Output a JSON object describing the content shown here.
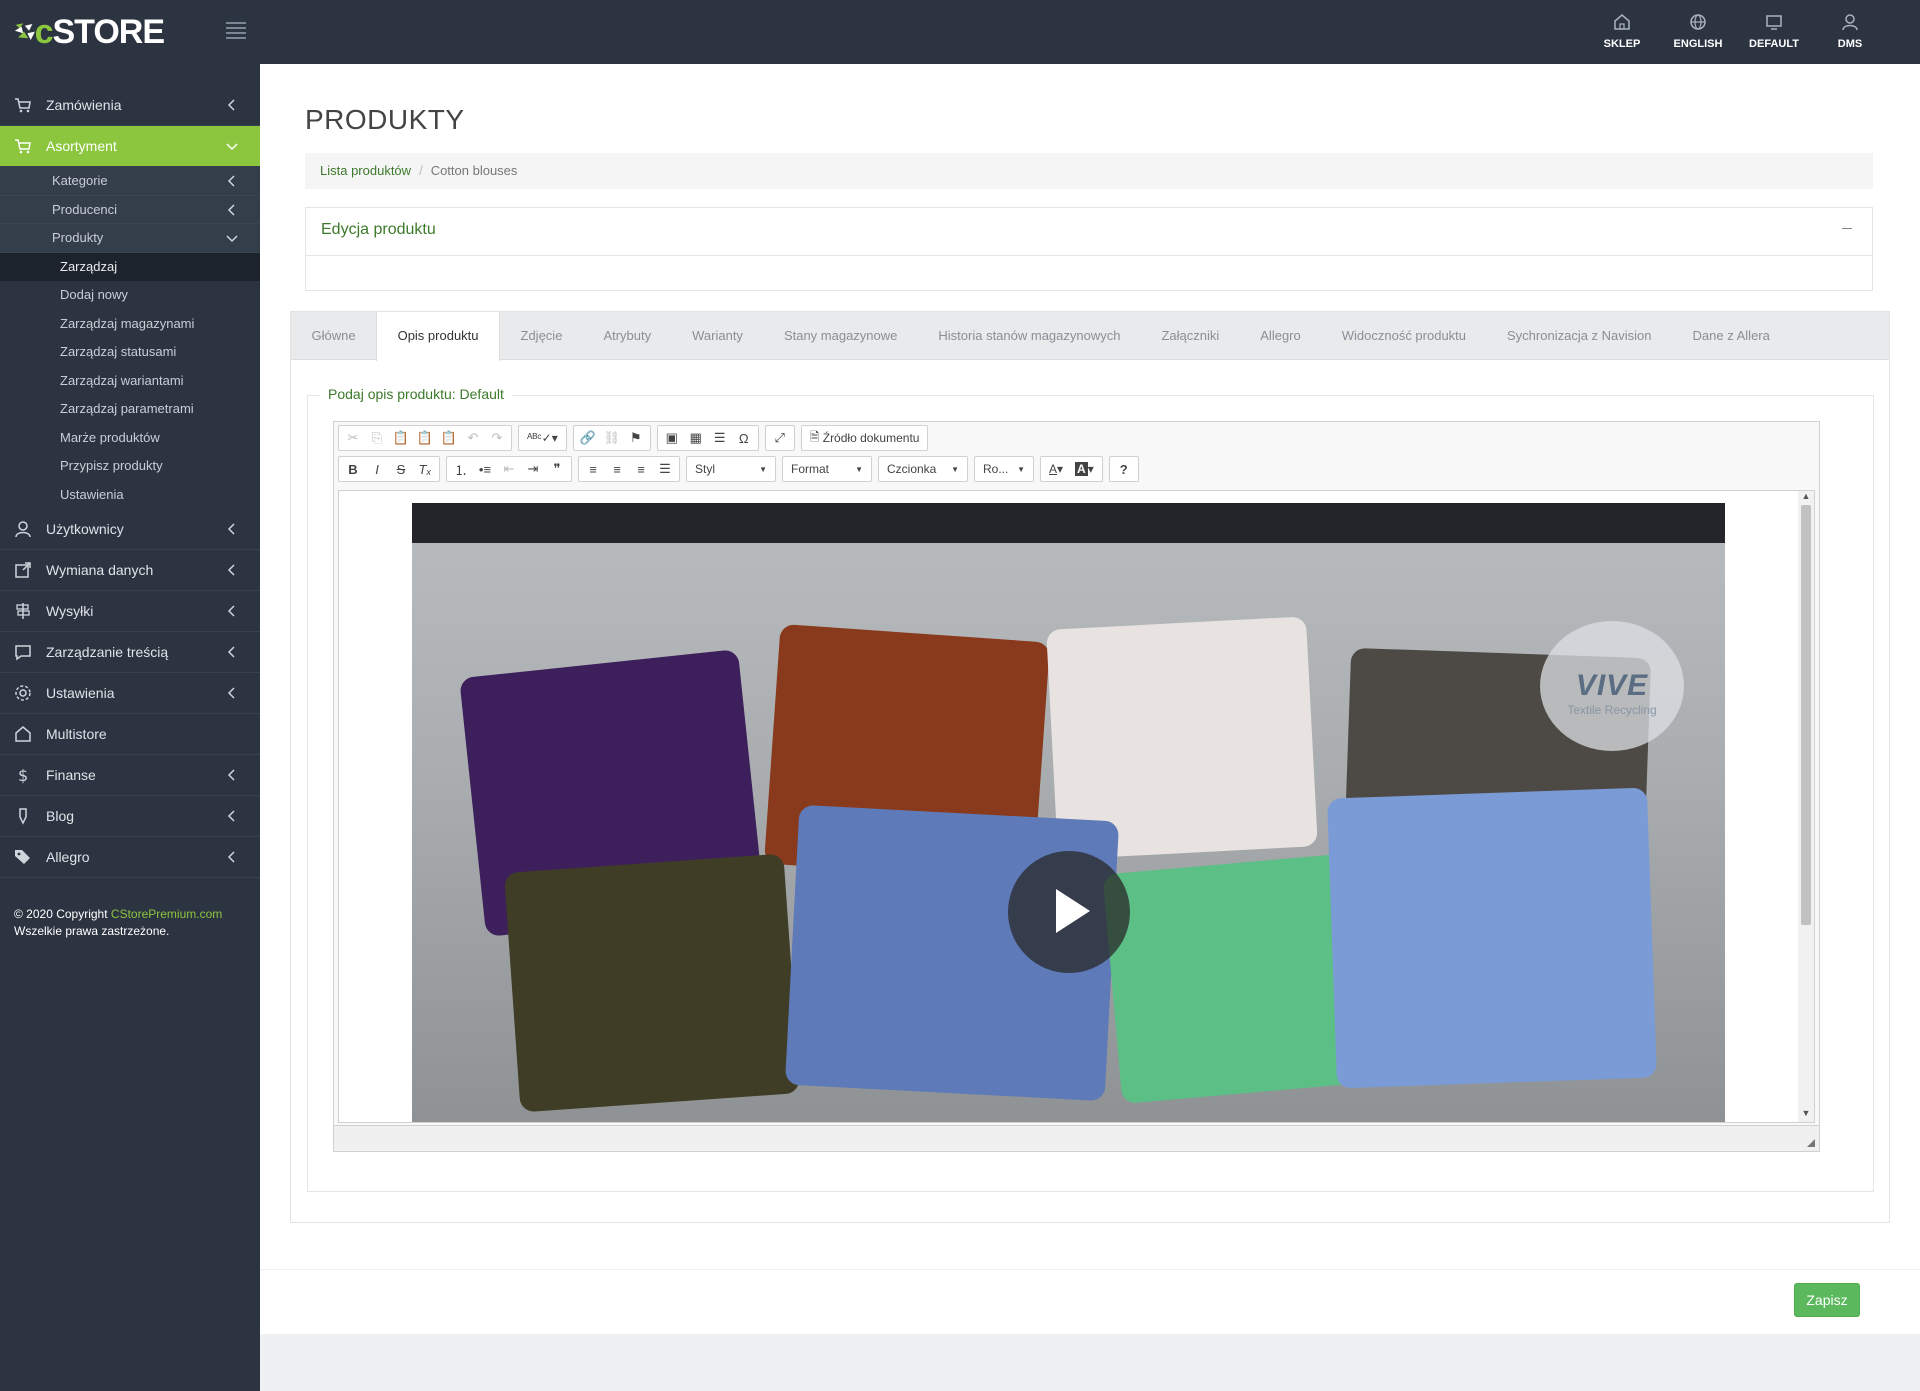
{
  "topbar": {
    "logo": "cSTORE",
    "actions": [
      {
        "label": "SKLEP",
        "icon": "home-icon"
      },
      {
        "label": "ENGLISH",
        "icon": "globe-icon"
      },
      {
        "label": "DEFAULT",
        "icon": "monitor-icon"
      },
      {
        "label": "DMS",
        "icon": "user-icon"
      }
    ]
  },
  "sidebar": {
    "items": [
      {
        "label": "Zamówienia",
        "icon": "cart-icon"
      },
      {
        "label": "Asortyment",
        "icon": "cart-icon"
      },
      {
        "label": "Użytkownicy",
        "icon": "user-icon"
      },
      {
        "label": "Wymiana danych",
        "icon": "external-link-icon"
      },
      {
        "label": "Wysyłki",
        "icon": "signpost-icon"
      },
      {
        "label": "Zarządzanie treścią",
        "icon": "comment-icon"
      },
      {
        "label": "Ustawienia",
        "icon": "gear-icon"
      },
      {
        "label": "Multistore",
        "icon": "home-icon"
      },
      {
        "label": "Finanse",
        "icon": "dollar-icon"
      },
      {
        "label": "Blog",
        "icon": "pen-icon"
      },
      {
        "label": "Allegro",
        "icon": "tags-icon"
      }
    ],
    "sub": [
      "Kategorie",
      "Producenci",
      "Produkty"
    ],
    "subsub": [
      "Zarządzaj",
      "Dodaj nowy",
      "Zarządzaj magazynami",
      "Zarządzaj statusami",
      "Zarządzaj wariantami",
      "Zarządzaj parametrami",
      "Marże produktów",
      "Przypisz produkty",
      "Ustawienia"
    ],
    "copyright_prefix": "© 2020 Copyright ",
    "copyright_link": "CStorePremium.com",
    "copyright_rights": "Wszelkie prawa zastrzeżone."
  },
  "main": {
    "title": "PRODUKTY",
    "breadcrumb": {
      "link": "Lista produktów",
      "sep": "/",
      "current": "Cotton blouses"
    },
    "panel_title": "Edycja produktu",
    "tabs": [
      "Główne",
      "Opis produktu",
      "Zdjęcie",
      "Atrybuty",
      "Warianty",
      "Stany magazynowe",
      "Historia stanów magazynowych",
      "Załączniki",
      "Allegro",
      "Widoczność produktu",
      "Sychronizacja z Navision",
      "Dane z Allera"
    ],
    "legend": "Podaj opis produktu: Default",
    "editor": {
      "source_label": "Źródło dokumentu",
      "combos": [
        "Styl",
        "Format",
        "Czcionka",
        "Ro..."
      ]
    },
    "video": {
      "watermark_brand": "VIVE",
      "watermark_sub": "Textile Recycling"
    },
    "save_label": "Zapisz"
  }
}
